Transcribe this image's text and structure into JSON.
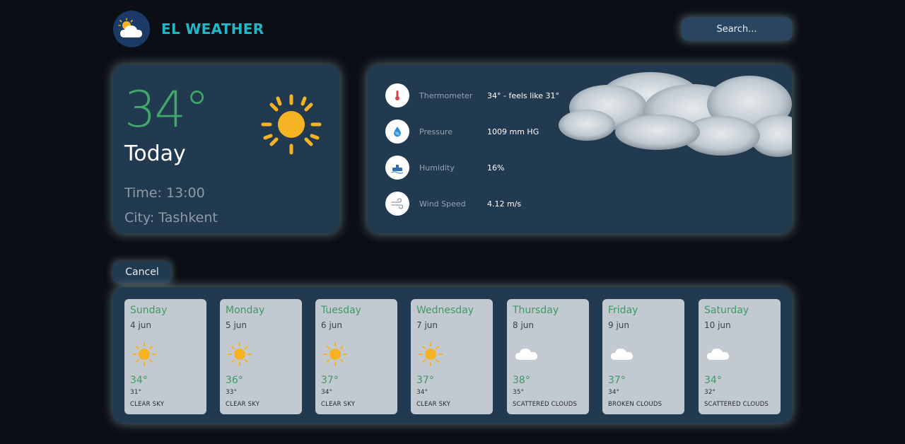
{
  "header": {
    "brand": "EL WEATHER",
    "search_label": "Search..."
  },
  "current": {
    "temperature": "34°",
    "day": "Today",
    "time": "Time: 13:00",
    "city": "City: Tashkent",
    "icon": "sun-icon"
  },
  "details": [
    {
      "label": "Thermometer",
      "value": "34° - feels like 31°",
      "icon": "thermometer-icon"
    },
    {
      "label": "Pressure",
      "value": "1009 mm HG",
      "icon": "pressure-drop-icon"
    },
    {
      "label": "Humidity",
      "value": "16%",
      "icon": "humidity-icon"
    },
    {
      "label": "Wind Speed",
      "value": "4.12 m/s",
      "icon": "wind-icon"
    }
  ],
  "cancel_label": "Cancel",
  "forecast": [
    {
      "day": "Sunday",
      "date": "4 jun",
      "high": "34°",
      "low": "31°",
      "desc": "CLEAR SKY",
      "icon": "sun-icon"
    },
    {
      "day": "Monday",
      "date": "5 jun",
      "high": "36°",
      "low": "33°",
      "desc": "CLEAR SKY",
      "icon": "sun-icon"
    },
    {
      "day": "Tuesday",
      "date": "6 jun",
      "high": "37°",
      "low": "34°",
      "desc": "CLEAR SKY",
      "icon": "sun-icon"
    },
    {
      "day": "Wednesday",
      "date": "7 jun",
      "high": "37°",
      "low": "34°",
      "desc": "CLEAR SKY",
      "icon": "sun-icon"
    },
    {
      "day": "Thursday",
      "date": "8 jun",
      "high": "38°",
      "low": "35°",
      "desc": "SCATTERED CLOUDS",
      "icon": "cloud-icon"
    },
    {
      "day": "Friday",
      "date": "9 jun",
      "high": "37°",
      "low": "34°",
      "desc": "BROKEN CLOUDS",
      "icon": "cloud-icon"
    },
    {
      "day": "Saturday",
      "date": "10 jun",
      "high": "34°",
      "low": "32°",
      "desc": "SCATTERED CLOUDS",
      "icon": "cloud-icon"
    }
  ],
  "colors": {
    "background": "#0b0e14",
    "card": "#223a50",
    "accent_green": "#3fa86a",
    "brand_teal": "#20b8c8",
    "sun": "#f5b323"
  }
}
